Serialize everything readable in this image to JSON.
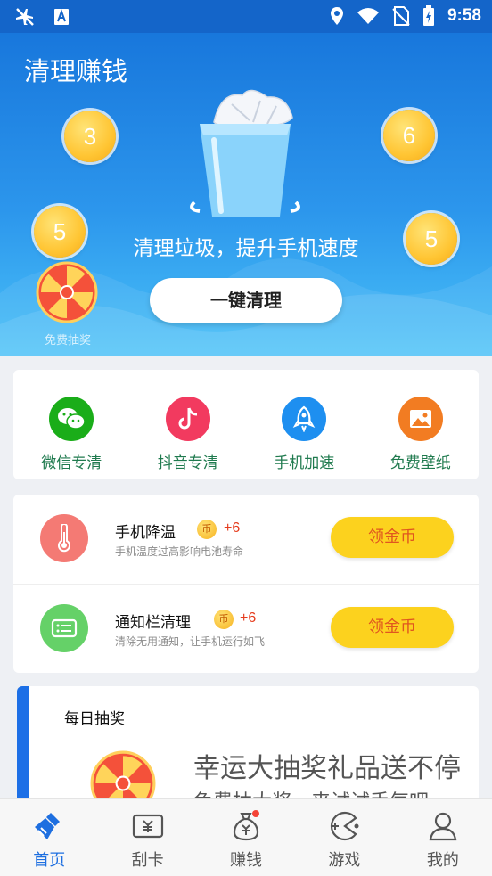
{
  "status_bar": {
    "time": "9:58"
  },
  "hero": {
    "title": "清理赚钱",
    "coins": [
      "3",
      "6",
      "5",
      "5"
    ],
    "slogan": "清理垃圾，提升手机速度",
    "clean_button": "一键清理",
    "lottery_label": "免费抽奖"
  },
  "tools": [
    {
      "label": "微信专清",
      "icon": "wechat-icon",
      "color": "#1aad19"
    },
    {
      "label": "抖音专清",
      "icon": "douyin-icon",
      "color": "#f23a5f"
    },
    {
      "label": "手机加速",
      "icon": "rocket-icon",
      "color": "#1e8ff0"
    },
    {
      "label": "免费壁纸",
      "icon": "image-icon",
      "color": "#f27c22"
    }
  ],
  "tasks": [
    {
      "title": "手机降温",
      "coin": "币",
      "reward": "+6",
      "desc": "手机温度过高影响电池寿命",
      "button": "领金币",
      "icon": "thermometer-icon",
      "color": "#f47a74"
    },
    {
      "title": "通知栏清理",
      "coin": "币",
      "reward": "+6",
      "desc": "清除无用通知，让手机运行如飞",
      "button": "领金币",
      "icon": "notification-icon",
      "color": "#65d168"
    }
  ],
  "daily": {
    "title": "每日抽奖",
    "headline": "幸运大抽奖礼品送不停",
    "subline": "免费抽大奖，来试试手气吧"
  },
  "nav": [
    {
      "label": "首页",
      "icon": "broom-icon",
      "active": true
    },
    {
      "label": "刮卡",
      "icon": "scratch-card-icon",
      "active": false
    },
    {
      "label": "赚钱",
      "icon": "money-bag-icon",
      "active": false
    },
    {
      "label": "游戏",
      "icon": "game-icon",
      "active": false
    },
    {
      "label": "我的",
      "icon": "user-icon",
      "active": false
    }
  ]
}
